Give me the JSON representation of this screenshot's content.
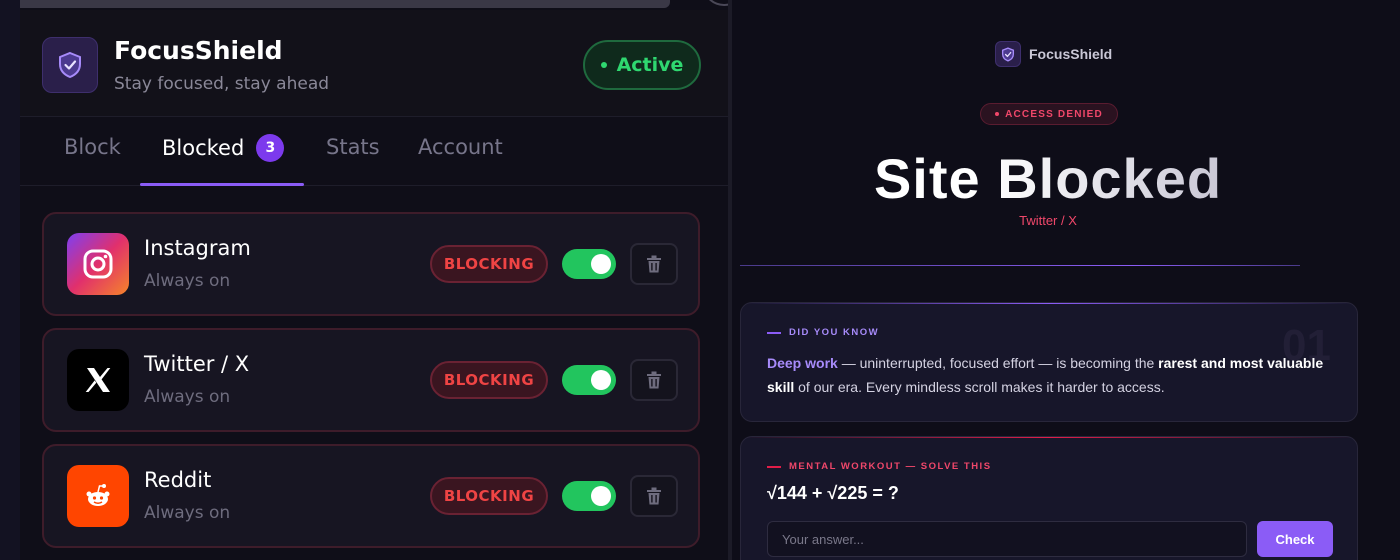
{
  "popup": {
    "brand": {
      "title": "FocusShield",
      "subtitle": "Stay focused, stay ahead",
      "icon": "shield-check-icon"
    },
    "status": {
      "label": "Active",
      "color": "#2fd870"
    },
    "tabs": [
      {
        "label": "Block"
      },
      {
        "label": "Blocked",
        "badge": "3",
        "selected": true
      },
      {
        "label": "Stats"
      },
      {
        "label": "Account"
      }
    ],
    "sites": [
      {
        "name": "Instagram",
        "schedule": "Always on",
        "status": "BLOCKING",
        "enabled": true,
        "icon": "instagram-icon"
      },
      {
        "name": "Twitter / X",
        "schedule": "Always on",
        "status": "BLOCKING",
        "enabled": true,
        "icon": "x-icon"
      },
      {
        "name": "Reddit",
        "schedule": "Always on",
        "status": "BLOCKING",
        "enabled": true,
        "icon": "reddit-icon"
      }
    ]
  },
  "blockpage": {
    "brand": "FocusShield",
    "badge": "ACCESS DENIED",
    "title": "Site Blocked",
    "site": "Twitter / X",
    "fact": {
      "label": "DID YOU KNOW",
      "number": "01",
      "term": "Deep work",
      "text1": " — uninterrupted, focused effort — is becoming the ",
      "emphasis": "rarest and most valuable skill",
      "text2": " of our era. Every mindless scroll makes it harder to access."
    },
    "quiz": {
      "label": "MENTAL WORKOUT — SOLVE THIS",
      "question": "√144 + √225 = ?",
      "placeholder": "Your answer...",
      "button": "Check"
    }
  },
  "colors": {
    "accent": "#8b5cf6",
    "danger": "#ef4444",
    "success": "#22c55e"
  }
}
